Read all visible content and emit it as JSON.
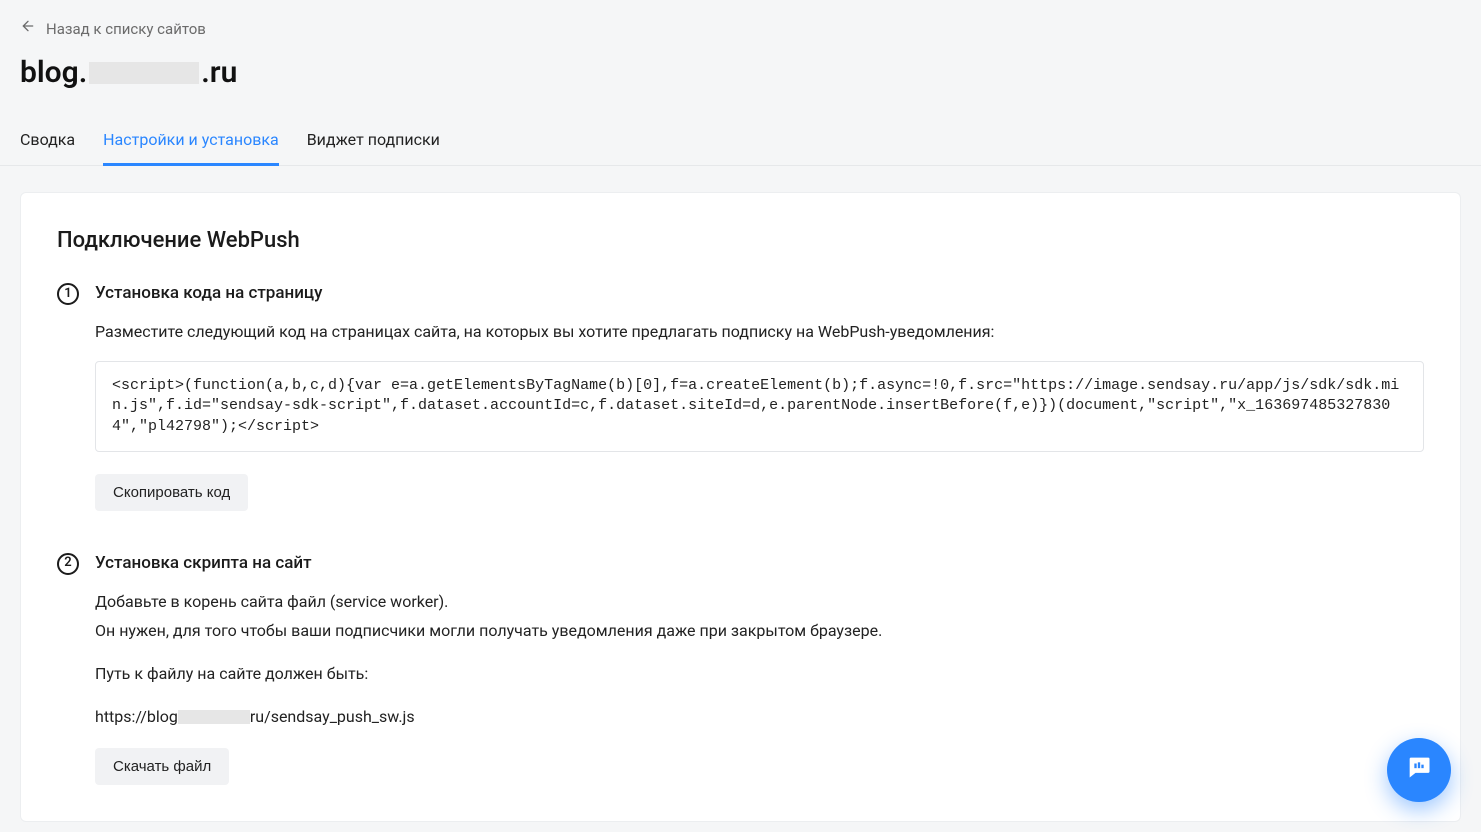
{
  "back_label": "Назад к списку сайтов",
  "site_title_prefix": "blog.",
  "site_title_suffix": ".ru",
  "tabs": {
    "summary": "Сводка",
    "settings": "Настройки и установка",
    "widget": "Виджет подписки"
  },
  "panel_title": "Подключение WebPush",
  "step1": {
    "num": "1",
    "title": "Установка кода на страницу",
    "desc": "Разместите следующий код на страницах сайта, на которых вы хотите предлагать подписку на WebPush-уведомления:",
    "code": "<script>(function(a,b,c,d){var e=a.getElementsByTagName(b)[0],f=a.createElement(b);f.async=!0,f.src=\"https://image.sendsay.ru/app/js/sdk/sdk.min.js\",f.id=\"sendsay-sdk-script\",f.dataset.accountId=c,f.dataset.siteId=d,e.parentNode.insertBefore(f,e)})(document,\"script\",\"x_1636974853278304\",\"pl42798\");</script>",
    "copy_btn": "Скопировать код"
  },
  "step2": {
    "num": "2",
    "title": "Установка скрипта на сайт",
    "line1": "Добавьте в корень сайта файл (service worker).",
    "line2": "Он нужен, для того чтобы ваши подписчики могли получать уведомления даже при закрытом браузере.",
    "line3": "Путь к файлу на сайте должен быть:",
    "url_prefix": "https://blog",
    "url_suffix": "ru/sendsay_push_sw.js",
    "download_btn": "Скачать файл"
  }
}
